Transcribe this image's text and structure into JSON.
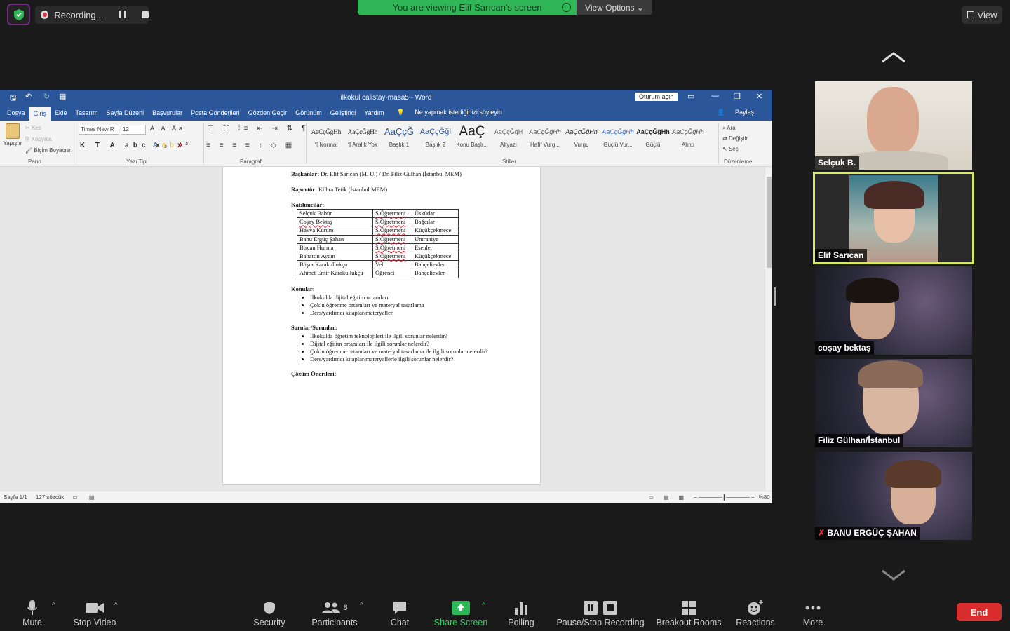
{
  "topbar": {
    "recording_label": "Recording...",
    "viewing_prefix": "You are viewing ",
    "viewing_name": "Elif Sarıcan's screen",
    "view_options": "View Options",
    "view_button": "View"
  },
  "word": {
    "title": "ilkokul calistay-masa5  -  Word",
    "signin": "Oturum açın",
    "tabs": [
      "Dosya",
      "Giriş",
      "Ekle",
      "Tasarım",
      "Sayfa Düzeni",
      "Başvurular",
      "Posta Gönderileri",
      "Gözden Geçir",
      "Görünüm",
      "Geliştirici",
      "Yardım"
    ],
    "tell_me": "Ne yapmak istediğinizi söyleyin",
    "share": "Paylaş",
    "ribbon": {
      "paste": "Yapıştır",
      "cut": "Kes",
      "copy": "Kopyala",
      "format_painter": "Biçim Boyacısı",
      "font_name": "Times New R",
      "font_size": "12",
      "groups": [
        "Pano",
        "Yazı Tipi",
        "Paragraf",
        "Stiller",
        "Düzenleme"
      ],
      "styles": [
        {
          "sample": "AaÇçĞğHh",
          "name": "¶ Normal"
        },
        {
          "sample": "AaÇçĞğHh",
          "name": "¶ Aralık Yok"
        },
        {
          "sample": "AaÇçĞ",
          "name": "Başlık 1"
        },
        {
          "sample": "AaÇçĞğI",
          "name": "Başlık 2"
        },
        {
          "sample": "AaÇ",
          "name": "Konu Başlı..."
        },
        {
          "sample": "AaÇçĞğH",
          "name": "Altyazı"
        },
        {
          "sample": "AaÇçĞğHh",
          "name": "Hafif Vurg..."
        },
        {
          "sample": "AaÇçĞğHh",
          "name": "Vurgu"
        },
        {
          "sample": "AaÇçĞğHh",
          "name": "Güçlü Vur..."
        },
        {
          "sample": "AaÇçĞğHh",
          "name": "Güçlü"
        },
        {
          "sample": "AaÇçĞğHh",
          "name": "Alıntı"
        }
      ],
      "find": "Ara",
      "replace": "Değiştir",
      "select": "Seç"
    },
    "doc": {
      "chairs_label": "Başkanlar:",
      "chairs_value": " Dr. Elif Sarıcan (M. U.) / Dr. Filiz Gülhan (İstanbul MEM)",
      "reporter_label": "Raportör:",
      "reporter_value": " Kübra Tetik (İstanbul MEM)",
      "participants_label": "Katılımcılar:",
      "participants": [
        [
          "Selçuk Babür",
          "S.Öğretmeni",
          "Üsküdar"
        ],
        [
          "Coşay Bektaş",
          "S.Öğretmeni",
          "Bağcılar"
        ],
        [
          "Havva Kurum",
          "S.Öğretmeni",
          "Küçükçekmece"
        ],
        [
          "Banu Ergüç Şahan",
          "S.Öğretmeni",
          "Umraniye"
        ],
        [
          "Bircan Hurma",
          "S.Öğretmeni",
          "Esenler"
        ],
        [
          "Bahattin Aydın",
          "S.Öğretmeni",
          "Küçükçekmece"
        ],
        [
          "Büşra Karakullukçu",
          "Veli",
          "Bahçelievler"
        ],
        [
          "Ahmet Emir Karakullukçu",
          "Öğrenci",
          "Bahçelievler"
        ]
      ],
      "topics_label": "Konular:",
      "topics": [
        "İlkokulda dijital eğitim ortamları",
        "Çoklu öğrenme ortamları ve materyal tasarlama",
        "Ders/yardımcı kitaplar/materyaller"
      ],
      "questions_label": "Sorular/Sorunlar:",
      "questions": [
        "İlkokulda öğretim teknolojileri ile ilgili sorunlar nelerdir?",
        "Dijital eğitim ortamları ile ilgili sorunlar nelerdir?",
        "Çoklu öğrenme ortamları ve materyal tasarlama ile ilgili sorunlar nelerdir?",
        "Ders/yardımcı kitaplar/materyallerle ilgili sorunlar nelerdir?"
      ],
      "solutions_label": "Çözüm Önerileri:"
    },
    "status": {
      "page": "Sayfa 1/1",
      "words": "127 sözcük",
      "zoom": "%80"
    }
  },
  "participants": [
    {
      "name": "Selçuk B."
    },
    {
      "name": "Elif Sarıcan"
    },
    {
      "name": "coşay bektaş"
    },
    {
      "name": "Filiz Gülhan/İstanbul"
    },
    {
      "name": "BANU ERGÜÇ ŞAHAN"
    }
  ],
  "toolbar": {
    "mute": "Mute",
    "stop_video": "Stop Video",
    "security": "Security",
    "participants": "Participants",
    "participant_count": "8",
    "chat": "Chat",
    "share_screen": "Share Screen",
    "polling": "Polling",
    "pause_stop_recording": "Pause/Stop Recording",
    "breakout_rooms": "Breakout Rooms",
    "reactions": "Reactions",
    "more": "More",
    "end": "End"
  },
  "colors": {
    "share_green": "#2fb757",
    "word_blue": "#2b579a",
    "end_red": "#d92c2c",
    "active_speaker": "#d6e96a"
  }
}
